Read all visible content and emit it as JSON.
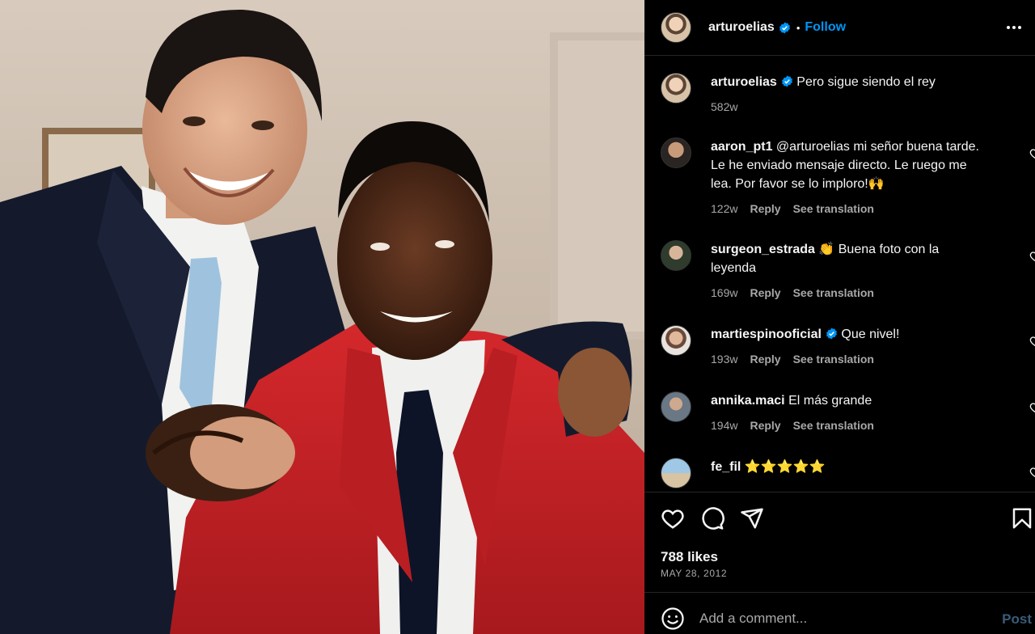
{
  "post": {
    "username": "arturoelias",
    "verified": true,
    "follow_label": "Follow",
    "dot": "•"
  },
  "comments": [
    {
      "user": "arturoelias",
      "verified": true,
      "text": "Pero sigue siendo el rey",
      "time": "582w"
    },
    {
      "user": "aaron_pt1",
      "verified": false,
      "text": "@arturoelias mi señor buena tarde. Le he enviado mensaje directo. Le ruego me lea. Por favor se lo imploro!🙌",
      "time": "122w",
      "reply": "Reply",
      "translate": "See translation"
    },
    {
      "user": "surgeon_estrada",
      "verified": false,
      "text": "👏 Buena foto con la leyenda",
      "time": "169w",
      "reply": "Reply",
      "translate": "See translation"
    },
    {
      "user": "martiespinooficial",
      "verified": true,
      "text": "Que nivel!",
      "time": "193w",
      "reply": "Reply",
      "translate": "See translation"
    },
    {
      "user": "annika.maci",
      "verified": false,
      "text": "El más grande",
      "time": "194w",
      "reply": "Reply",
      "translate": "See translation"
    },
    {
      "user": "fe_fil",
      "verified": false,
      "text": "⭐⭐⭐⭐⭐"
    }
  ],
  "stats": {
    "likes": "788 likes",
    "date": "MAY 28, 2012"
  },
  "compose": {
    "placeholder": "Add a comment...",
    "post_label": "Post"
  },
  "icons": {
    "more": "more-options-icon",
    "like": "heart-icon",
    "comment": "comment-icon",
    "share": "send-icon",
    "save": "bookmark-icon",
    "emoji": "emoji-icon",
    "verified": "verified-badge-icon"
  },
  "colors": {
    "background": "#000000",
    "text": "#f5f5f5",
    "secondary_text": "#a8a8a8",
    "link": "#0095f6",
    "verified": "#0095f6",
    "divider": "#262626"
  }
}
